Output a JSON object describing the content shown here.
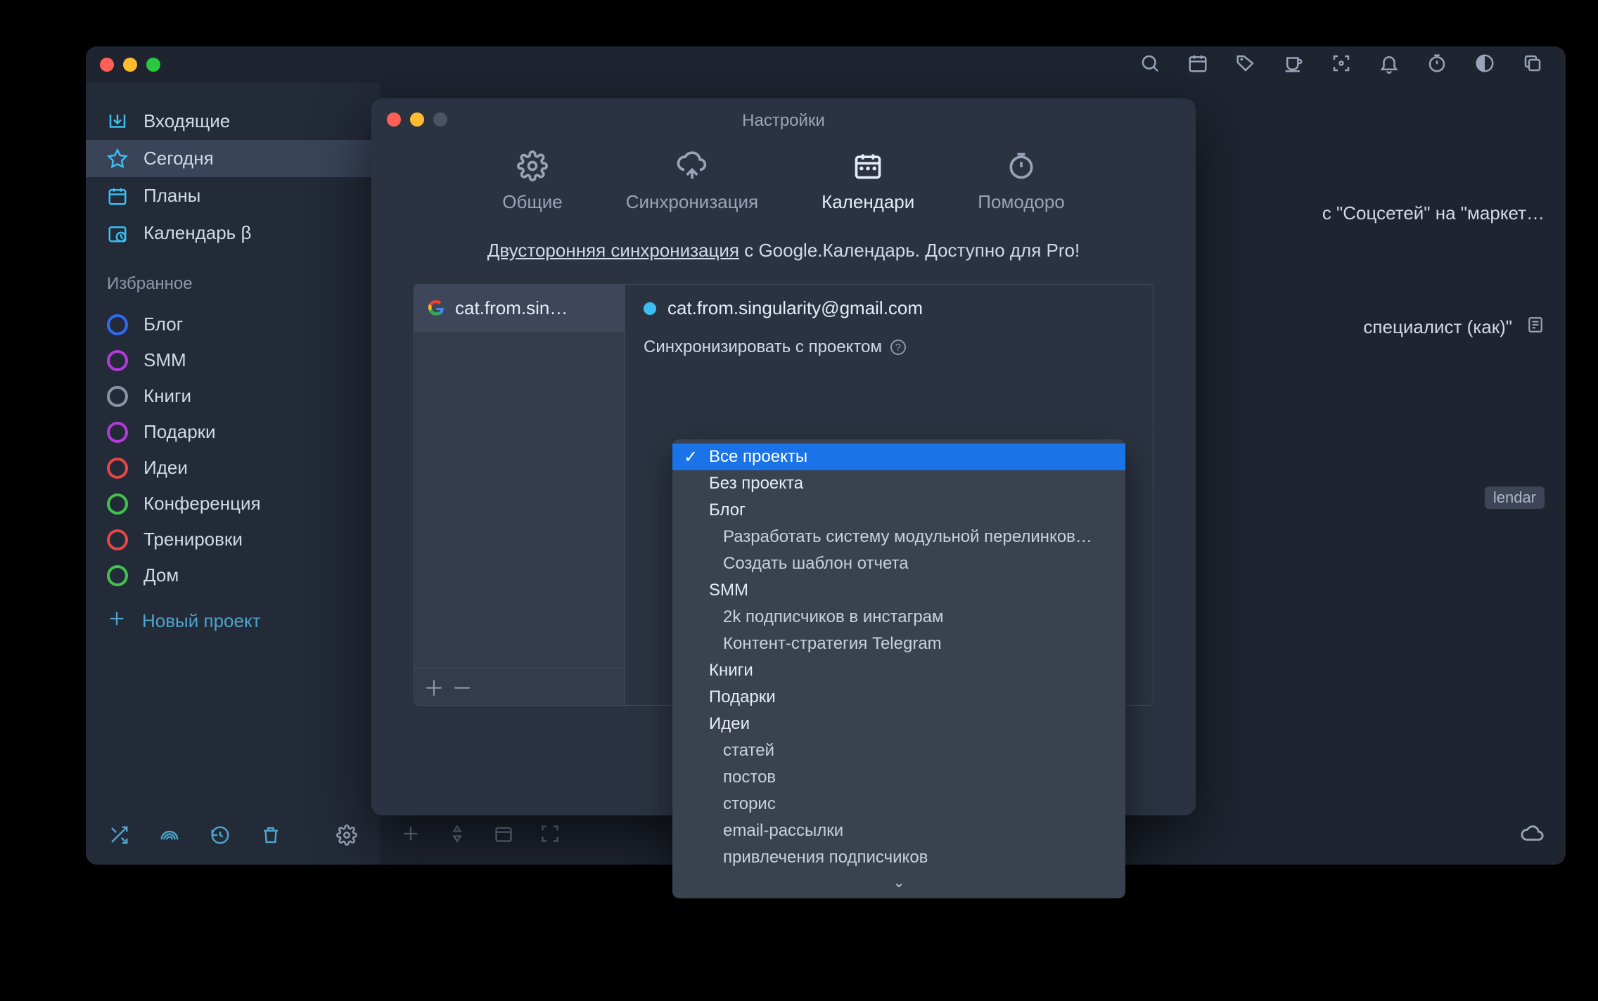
{
  "main": {
    "nav": {
      "inbox": "Входящие",
      "today": "Сегодня",
      "plans": "Планы",
      "calendar": "Календарь β"
    },
    "favorites_header": "Избранное",
    "projects": [
      {
        "name": "Блог",
        "color": "#2f6af0"
      },
      {
        "name": "SMM",
        "color": "#b23bd6"
      },
      {
        "name": "Книги",
        "color": "#8a93a6"
      },
      {
        "name": "Подарки",
        "color": "#b23bd6"
      },
      {
        "name": "Идеи",
        "color": "#e54646"
      },
      {
        "name": "Конференция",
        "color": "#41c24a"
      },
      {
        "name": "Тренировки",
        "color": "#e54646"
      },
      {
        "name": "Дом",
        "color": "#41c24a"
      }
    ],
    "new_project": "Новый проект",
    "content_row_1": "с \"Соцсетей\" на \"маркет…",
    "content_row_2": "специалист (как)\"",
    "content_tag": "lendar"
  },
  "settings": {
    "title": "Настройки",
    "tabs": {
      "general": "Общие",
      "sync": "Синхронизация",
      "calendars": "Календари",
      "pomodoro": "Помодоро"
    },
    "promo_link": "Двусторонняя синхронизация",
    "promo_rest": " с Google.Календарь. Доступно для Pro!",
    "account_short": "cat.from.sin…",
    "account_email": "cat.from.singularity@gmail.com",
    "sync_label": "Синхронизировать с проектом"
  },
  "dropdown": {
    "items": [
      {
        "label": "Все проекты",
        "selected": true
      },
      {
        "label": "Без проекта"
      },
      {
        "label": "Блог"
      },
      {
        "label": "Разработать систему модульной перелинков…",
        "sub": true
      },
      {
        "label": "Создать шаблон отчета",
        "sub": true
      },
      {
        "label": "SMM"
      },
      {
        "label": "2k подписчиков в инстаграм",
        "sub": true
      },
      {
        "label": "Контент-стратегия Telegram",
        "sub": true
      },
      {
        "label": "Книги"
      },
      {
        "label": "Подарки"
      },
      {
        "label": "Идеи"
      },
      {
        "label": "статей",
        "sub": true
      },
      {
        "label": "постов",
        "sub": true
      },
      {
        "label": "сторис",
        "sub": true
      },
      {
        "label": "email-рассылки",
        "sub": true
      },
      {
        "label": "привлечения подписчиков",
        "sub": true
      }
    ]
  }
}
